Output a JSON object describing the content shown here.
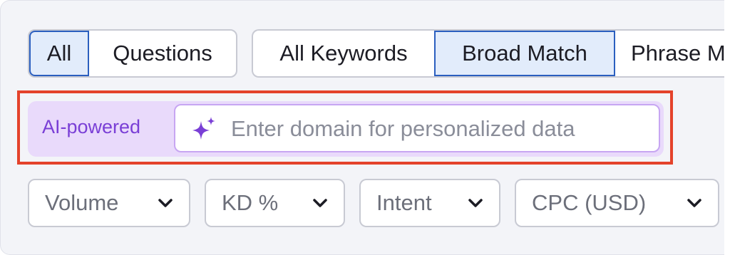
{
  "match_tabs": {
    "group1": [
      {
        "label": "All",
        "selected": true
      },
      {
        "label": "Questions",
        "selected": false
      }
    ],
    "group2": [
      {
        "label": "All Keywords",
        "selected": false
      },
      {
        "label": "Broad Match",
        "selected": true
      },
      {
        "label": "Phrase Match",
        "selected": false
      }
    ]
  },
  "ai_search": {
    "label": "AI-powered",
    "placeholder": "Enter domain for personalized data",
    "value": "",
    "icon": "sparkle-icon",
    "accent_color": "#7a3fd6",
    "highlight_color": "#e4422b"
  },
  "filters": [
    {
      "label": "Volume",
      "icon": "chevron-down-icon"
    },
    {
      "label": "KD %",
      "icon": "chevron-down-icon"
    },
    {
      "label": "Intent",
      "icon": "chevron-down-icon"
    },
    {
      "label": "CPC (USD)",
      "icon": "chevron-down-icon"
    }
  ]
}
